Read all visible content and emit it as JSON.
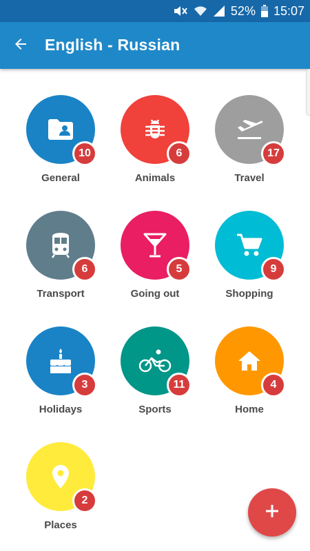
{
  "status_bar": {
    "battery": "52%",
    "time": "15:07",
    "icons": [
      "mute-icon",
      "wifi-icon",
      "signal-icon",
      "battery-icon"
    ]
  },
  "header": {
    "back_icon": "arrow-left-icon",
    "title": "English - Russian"
  },
  "categories": [
    {
      "label": "General",
      "count": "10",
      "color": "#1a83c6",
      "icon": "folder-user-icon"
    },
    {
      "label": "Animals",
      "count": "6",
      "color": "#f0413a",
      "icon": "bug-icon"
    },
    {
      "label": "Travel",
      "count": "17",
      "color": "#9e9e9e",
      "icon": "plane-departure-icon"
    },
    {
      "label": "Transport",
      "count": "6",
      "color": "#607d8b",
      "icon": "train-icon"
    },
    {
      "label": "Going out",
      "count": "5",
      "color": "#e91e63",
      "icon": "cocktail-icon"
    },
    {
      "label": "Shopping",
      "count": "9",
      "color": "#00bcd4",
      "icon": "shopping-cart-icon"
    },
    {
      "label": "Holidays",
      "count": "3",
      "color": "#1a83c6",
      "icon": "cake-icon"
    },
    {
      "label": "Sports",
      "count": "11",
      "color": "#009688",
      "icon": "bicycle-icon"
    },
    {
      "label": "Home",
      "count": "4",
      "color": "#ff9800",
      "icon": "home-icon"
    },
    {
      "label": "Places",
      "count": "2",
      "color": "#ffeb3b",
      "icon": "location-pin-icon"
    }
  ],
  "colors": {
    "status_bar": "#1768a8",
    "app_bar": "#1f88c9",
    "badge": "#d63c3c",
    "fab": "#e04848"
  },
  "fab": {
    "icon": "plus-icon"
  }
}
